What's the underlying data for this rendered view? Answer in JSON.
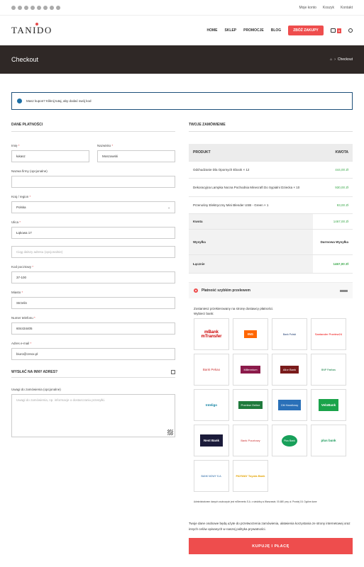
{
  "topbar": {
    "links": [
      "Moje konto",
      "Koszyk",
      "Kontakt"
    ]
  },
  "header": {
    "logo": "TANIDO",
    "nav": [
      "HOME",
      "SKLEP",
      "PROMOCJE",
      "BLOG"
    ],
    "cta": "ZBÓŻ ZAKUPY",
    "cart_count": "0"
  },
  "hero": {
    "title": "Checkout",
    "breadcrumb_current": "Checkout"
  },
  "notice": {
    "text": "Masz kupon? Kliknij tutaj, aby dodać swój kod"
  },
  "billing": {
    "title": "DANE PŁATNOŚCI",
    "first_name_label": "Imię",
    "first_name": "łukasz",
    "last_name_label": "Nazwisko",
    "last_name": "Moszowski",
    "company_label": "Nazwa firmy (opcjonalne)",
    "company": "",
    "country_label": "Kraj / region",
    "country": "Polska",
    "street_label": "Ulica",
    "street": "Łąkowa 17",
    "street2_placeholder": "Ciąg dalszy adresu (opcjonalnie)",
    "postcode_label": "Kod pocztowy",
    "postcode": "37-100",
    "city_label": "Miasto",
    "city": "Strzelin",
    "phone_label": "Numer telefonu",
    "phone": "604434405",
    "email_label": "Adres e-mail",
    "email": "biuro@creox.pl",
    "ship_other": "WYSŁAĆ NA INNY ADRES?",
    "notes_label": "Uwagi do zamówienia (opcjonalne)",
    "notes_placeholder": "Uwagi do zamówienia, np. informacje o dostarczaniu przesyłki."
  },
  "order": {
    "title": "TWOJE ZAMÓWIENIE",
    "col_product": "PRODUKT",
    "col_amount": "KWOTA",
    "items": [
      {
        "name": "Odchudzanie Dla Opornych Ebook × 12",
        "amount": "444,00 Zł"
      },
      {
        "name": "Dekoracyjna Lampka Nocna Pochodnia Minecraft Do Sypialni Dziecka × 10",
        "amount": "930,00 Zł"
      },
      {
        "name": "Przenośny Elektryczny Mini Blender USB - Green × 1",
        "amount": "93,00 Zł"
      }
    ],
    "subtotal_label": "Kwota",
    "subtotal": "1467,00 Zł",
    "shipping_label": "Wysyłka",
    "shipping": "Darmowa Wysyłka",
    "total_label": "Łącznie",
    "total": "1467,00 Zł"
  },
  "payment": {
    "method": "Płatność szybkim przelewem",
    "desc": "Zostaniesz przekierowany na stronę dostawcy płatności.",
    "choose": "Wybierz bank:",
    "banks": [
      "mBank mTransfer",
      "ING",
      "Bank Polski",
      "Santander Przelew24",
      "Bank Pekao",
      "Millennium",
      "Alior Bank",
      "BNP Paribas",
      "Inteligo",
      "Przelew Online",
      "Citi Handlowy",
      "VeloBank",
      "Nest Bank",
      "Bank Pocztowy",
      "Plus Bank",
      "plus bank",
      "BANK NOWY S.A.",
      "PAYWAY Toyota Bank"
    ],
    "fine": "Administratorem danych osobowych jest mElements S.A. z siedzibą w Warszawie, 00-680 przy ul. Prostej 18. Ogólne dane",
    "privacy": "Twoje dane osobowe będą użyte do przetworzenia zamówienia, ułatwienia korzystania ze strony internetowej oraz innych celów opisanych w naszej polityka prywatności.",
    "button": "KUPUJĘ I PŁACĘ"
  }
}
